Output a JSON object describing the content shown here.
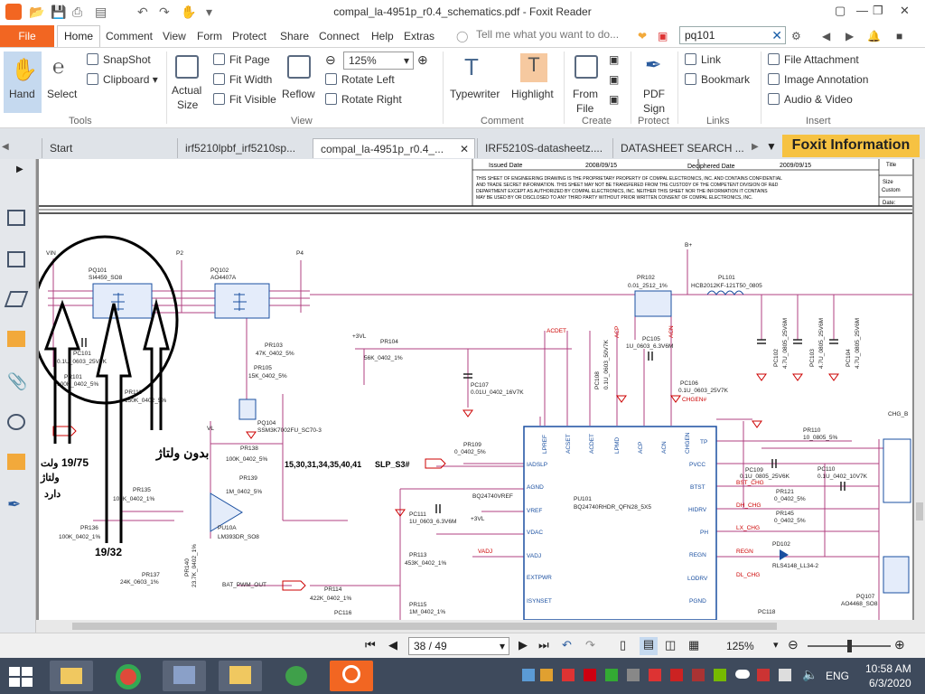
{
  "window": {
    "title": "compal_la-4951p_r0.4_schematics.pdf - Foxit Reader"
  },
  "menu": {
    "file": "File",
    "home": "Home",
    "items": [
      "Comment",
      "View",
      "Form",
      "Protect",
      "Share",
      "Connect",
      "Help",
      "Extras"
    ],
    "tellme": "Tell me what you want to do...",
    "search_value": "pq101"
  },
  "ribbon": {
    "hand": "Hand",
    "select": "Select",
    "snapshot": "SnapShot",
    "clipboard": "Clipboard",
    "group_tools": "Tools",
    "actual_size": [
      "Actual",
      "Size"
    ],
    "fit_page": "Fit Page",
    "fit_width": "Fit Width",
    "fit_visible": "Fit Visible",
    "reflow": "Reflow",
    "zoom": "125%",
    "rotate_left": "Rotate Left",
    "rotate_right": "Rotate Right",
    "group_view": "View",
    "typewriter": "Typewriter",
    "highlight": "Highlight",
    "group_comment": "Comment",
    "from_file": [
      "From",
      "File"
    ],
    "group_create": "Create",
    "pdf_sign": [
      "PDF",
      "Sign"
    ],
    "group_protect": "Protect",
    "link": "Link",
    "bookmark": "Bookmark",
    "group_links": "Links",
    "file_attachment": "File Attachment",
    "image_annotation": "Image Annotation",
    "audio_video": "Audio & Video",
    "group_insert": "Insert"
  },
  "tabs": [
    {
      "label": "Start"
    },
    {
      "label": "irf5210lpbf_irf5210sp..."
    },
    {
      "label": "compal_la-4951p_r0.4_..."
    },
    {
      "label": "IRF5210S-datasheetz...."
    },
    {
      "label": "DATASHEET SEARCH ..."
    }
  ],
  "foxit_info": "Foxit Information",
  "schematic": {
    "header": {
      "issued_label": "Issued Date",
      "issued_date": "2008/09/15",
      "deciphered_label": "Deciphered Date",
      "deciphered_date": "2009/09/15",
      "title_label": "Title",
      "size_label": "Size",
      "custom_label": "Custom",
      "date_label": "Date:",
      "legal": [
        "THIS SHEET OF ENGINEERING DRAWING IS THE PROPRIETARY PROPERTY OF COMPAL ELECTRONICS, INC. AND CONTAINS CONFIDENTIAL",
        "AND TRADE SECRET INFORMATION. THIS SHEET MAY NOT BE TRANSFERED FROM THE CUSTODY OF THE COMPETENT DIVISION OF R&D",
        "DEPARTMENT EXCEPT AS AUTHORIZED BY COMPAL ELECTRONICS, INC. NEITHER THIS SHEET NOR THE INFORMATION IT CONTAINS",
        "MAY BE USED BY OR DISCLOSED TO ANY THIRD PARTY WITHOUT PRIOR WRITTEN CONSENT OF COMPAL ELECTRONICS, INC."
      ]
    },
    "labels": {
      "vin": "VIN",
      "p2": "P2",
      "p4": "P4",
      "bplus": "B+",
      "pq101": "PQ101",
      "pq101_part": "SI4459_SO8",
      "pq102": "PQ102",
      "pq102_part": "AO4407A",
      "pr102": "PR102",
      "pr102_val": "0.01_2512_1%",
      "pl101": "PL101",
      "pl101_val": "HCB2012KF-121T50_0805",
      "pc101": "PC101",
      "pc101_val": "0.1U_0603_25V7K",
      "pr101": "PR101",
      "pr101_val": "100K_0402_5%",
      "pr111": "PR111",
      "pr111_val": "150K_0402_5%",
      "pr103": "PR103",
      "pr103_val": "47K_0402_5%",
      "pr105": "PR105",
      "pr105_val": "15K_0402_5%",
      "pq104": "PQ104",
      "pq104_part": "SSM3K7002FU_SC70-3",
      "vl": "VL",
      "pr138": "PR138",
      "pr138_val": "100K_0402_5%",
      "pr139": "PR139",
      "pr139_val": "1M_0402_5%",
      "pins": "15,30,31,34,35,40,41",
      "slp": "SLP_S3#",
      "pr135": "PR135",
      "pr135_val": "100K_0402_1%",
      "pr136": "PR136",
      "pr136_val": "100K_0402_1%",
      "pu10a": "PU10A",
      "pu10a_part": "LM393DR_SO8",
      "pr137": "PR137",
      "pr137_val": "24K_0603_1%",
      "pr140": "PR140",
      "pr140_val": "23.7K_0402_1%",
      "bat_pwm": "BAT_PWM_OUT",
      "pr114": "PR114",
      "pr114_val": "422K_0402_1%",
      "pc116": "PC116",
      "pr115": "PR115",
      "pr115_val": "1M_0402_1%",
      "pr104": "PR104",
      "pr104_val": "56K_0402_1%",
      "plus3vl": "+3VL",
      "pc107": "PC107",
      "pc107_val": "0.01U_0402_16V7K",
      "acdet": "ACDET",
      "pc108": "PC108",
      "pc108_val": "0.1U_0603_50V7K",
      "acp": "ACP",
      "acn": "ACN",
      "pc105": "PC105",
      "pc105_val": "1U_0603_6.3V6M",
      "pc106": "PC106",
      "pc106_val": "0.1U_0603_25V7K",
      "chgen": "CHGEN#",
      "pc102": "PC102",
      "pc103": "PC103",
      "pc104": "PC104",
      "pc_val": "4.7U_0805_25V6M",
      "pr109": "PR109",
      "pr109_val": "0_0402_5%",
      "bq_vref": "BQ24740VREF",
      "pc111": "PC111",
      "pc111_val": "1U_0603_6.3V6M",
      "plus3vl_b": "+3VL",
      "pr113": "PR113",
      "pr113_val": "453K_0402_1%",
      "vadj": "VADJ",
      "pu101": "PU101",
      "pu101_part": "BQ24740RHDR_QFN28_5X5",
      "pr110": "PR110",
      "pr110_val": "10_0805_5%",
      "pc109": "PC109",
      "pc109_val": "0.1U_0805_25V6K",
      "pc110": "PC110",
      "pc110_val": "0.1U_0402_10V7K",
      "pr121": "PR121",
      "pr121_val": "0_0402_5%",
      "pr145": "PR145",
      "pr145_val": "0_0402_5%",
      "bst_chg": "BST_CHG",
      "dh_chg": "DH_CHG",
      "lx_chg": "LX_CHG",
      "regn": "REGN",
      "dl_chg": "DL_CHG",
      "pd102": "PD102",
      "pd102_part": "RLS4148_LL34-2",
      "pq107": "PQ107",
      "pq107_part": "AO4468_SO8",
      "pc118": "PC118",
      "chg_b": "CHG_B",
      "pin_left": [
        "IADSLP",
        "AGND",
        "VREF",
        "VDAC",
        "VADJ",
        "EXTPWR",
        "ISYNSET"
      ],
      "pin_top": [
        "LPREF",
        "ACSET",
        "ACDET",
        "LPMD",
        "ACP",
        "ACN",
        "CHGEN"
      ],
      "pin_right": [
        "TP",
        "PVCC",
        "BTST",
        "HIDRV",
        "PH",
        "REGN",
        "LODRV",
        "PGND"
      ]
    },
    "annotations": {
      "arabic_no_voltage": "بدون ولتاژ",
      "a_19_75": "19/75",
      "arabic_volt": "ولت",
      "arabic_voltage_has": "ولتاژ",
      "arabic_darad": "دارد",
      "a_19_32": "19/32"
    }
  },
  "status": {
    "page": "38 / 49",
    "zoom": "125%"
  },
  "taskbar": {
    "lang": "ENG",
    "time": "10:58 AM",
    "date": "6/3/2020"
  },
  "colors": {
    "accent": "#f26622",
    "schematic_red": "#cc0000",
    "wire_pink": "#b04080",
    "foxit_info_bg": "#f6c242"
  }
}
